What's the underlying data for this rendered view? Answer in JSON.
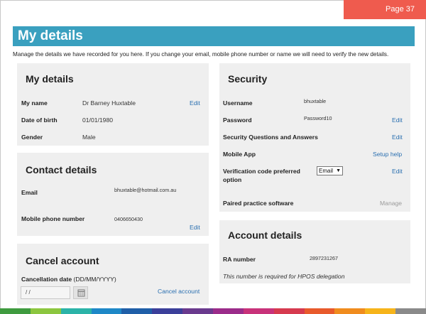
{
  "page": {
    "tab": "Page 37",
    "title": "My details",
    "intro": "Manage the details we have recorded for you here. If you change your email, mobile phone number or name we will need to verify the new details."
  },
  "my_details": {
    "title": "My details",
    "name_label": "My name",
    "name_value": "Dr Barney Huxtable",
    "edit": "Edit",
    "dob_label": "Date of birth",
    "dob_value": "01/01/1980",
    "gender_label": "Gender",
    "gender_value": "Male"
  },
  "contact": {
    "title": "Contact details",
    "email_label": "Email",
    "email_value": "bhuxtable@hotmail.com.au",
    "mobile_label": "Mobile phone number",
    "mobile_value": "0406650430",
    "edit": "Edit"
  },
  "cancel": {
    "title": "Cancel account",
    "date_label": "Cancellation date",
    "date_hint": "(DD/MM/YYYY)",
    "date_value": "/ /",
    "link": "Cancel account"
  },
  "security": {
    "title": "Security",
    "username_label": "Username",
    "username_value": "bhuxtable",
    "password_label": "Password",
    "password_value": "Password10",
    "password_edit": "Edit",
    "questions_label": "Security Questions and Answers",
    "questions_edit": "Edit",
    "app_label": "Mobile App",
    "app_link": "Setup help",
    "verification_label_1": "Verification code preferred",
    "verification_label_2": "option",
    "verification_value": "Email",
    "verification_edit": "Edit",
    "paired_label": "Paired practice software",
    "paired_link": "Manage"
  },
  "account": {
    "title": "Account details",
    "ra_label": "RA number",
    "ra_value": "2897231267",
    "note": "This number is required for HPOS delegation"
  },
  "colors": {
    "header": "#3aa0bf",
    "tab": "#ef5b4e",
    "link": "#2a6fb0",
    "panel": "#efefef"
  },
  "footer_stripe": [
    "#3f9b3f",
    "#8cc63f",
    "#2bb3a8",
    "#1e88c7",
    "#1f5fa8",
    "#3b3f9a",
    "#6a3a8e",
    "#9b2c8a",
    "#c8327a",
    "#d63a4f",
    "#e85a2c",
    "#f08c1e",
    "#f6b41a",
    "#8a8a8a"
  ]
}
